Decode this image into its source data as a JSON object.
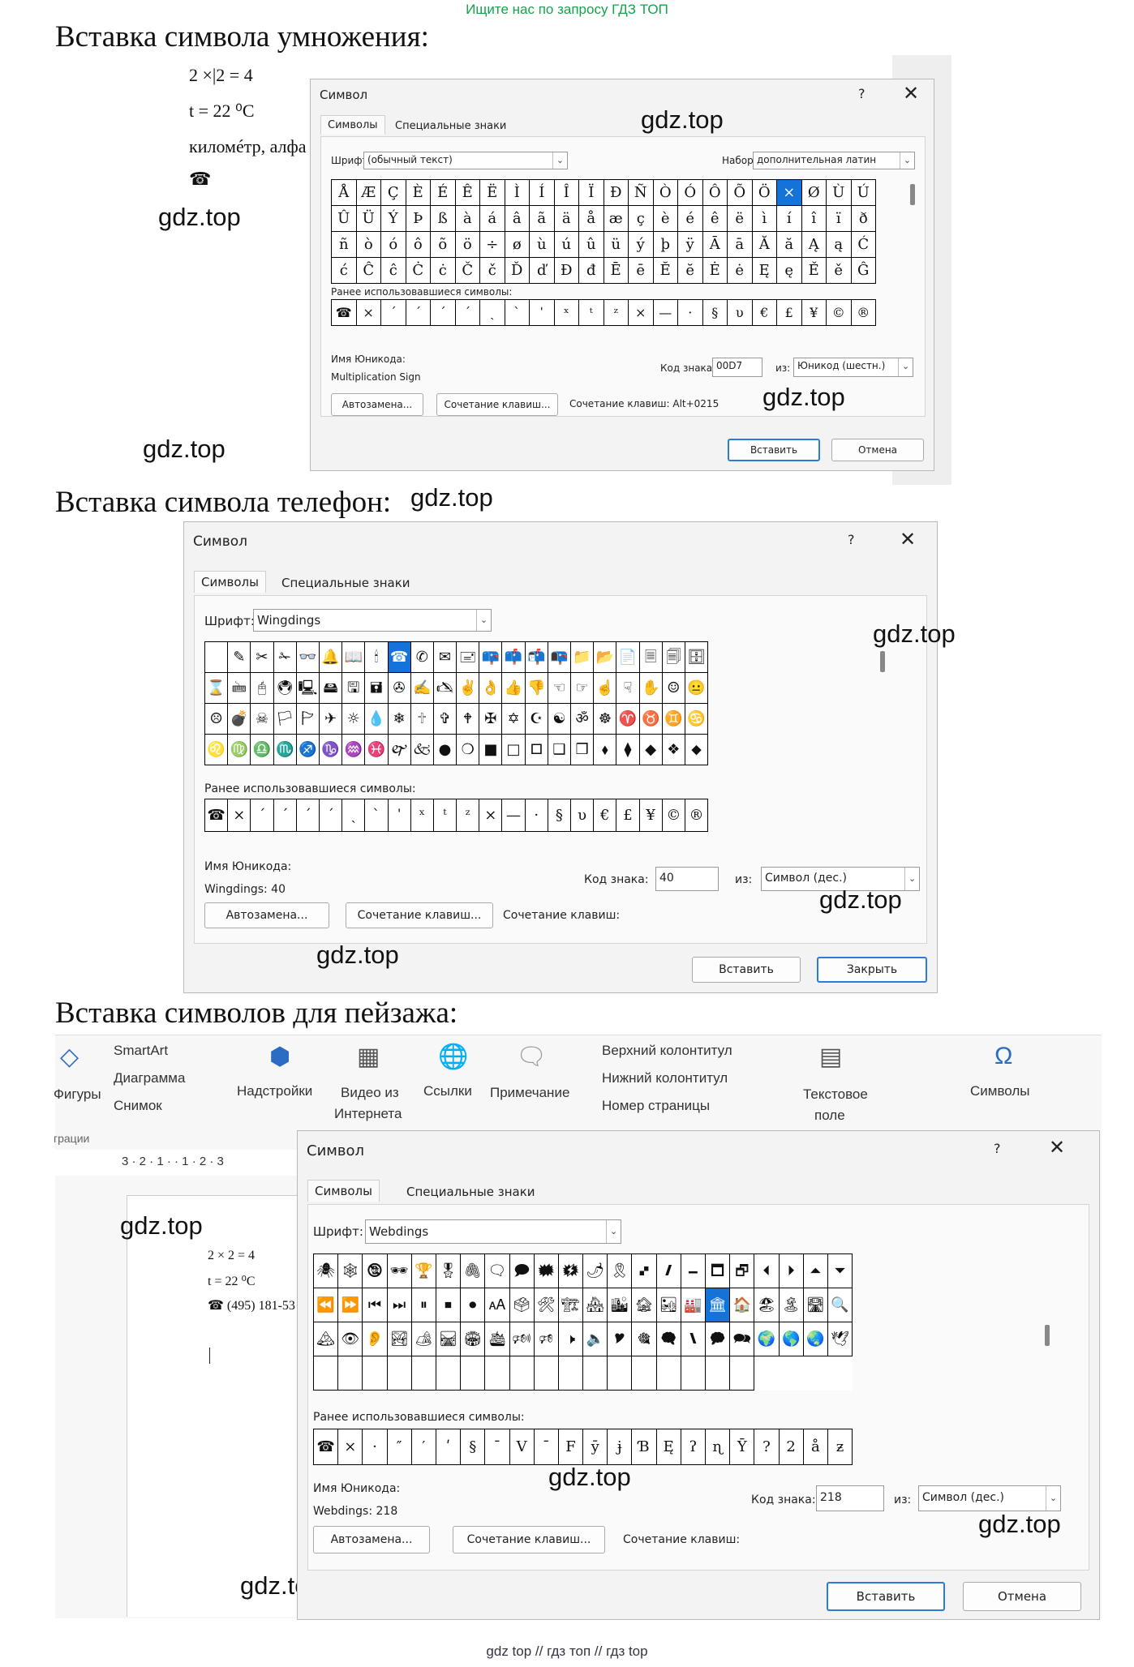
{
  "banner": "Ищите нас по запросу ГДЗ ТОП",
  "footer": "gdz top  //  гдз топ  //  гдз top",
  "watermark": "gdz.top",
  "sections": {
    "mult": "Вставка символа умножения:",
    "phone": "Вставка символа телефон:",
    "landscape": "Вставка символов для пейзажа:"
  },
  "doc1": {
    "line1": "2 ×|2 = 4",
    "line2": "t = 22 ⁰C",
    "line3": "киломéтр, алфа",
    "line4": "☎"
  },
  "dialog1": {
    "title": "Символ",
    "help": "?",
    "close": "✕",
    "tab_symbols": "Символы",
    "tab_special": "Специальные знаки",
    "font_label": "Шрифт:",
    "font_value": "(обычный текст)",
    "set_label": "Набор:",
    "set_value": "дополнительная латин",
    "cells": [
      "Å",
      "Æ",
      "Ç",
      "È",
      "É",
      "Ê",
      "Ë",
      "Ì",
      "Í",
      "Î",
      "Ï",
      "Ð",
      "Ñ",
      "Ò",
      "Ó",
      "Ô",
      "Õ",
      "Ö",
      "×",
      "Ø",
      "Ù",
      "Ú",
      "Û",
      "Ü",
      "Ý",
      "Þ",
      "ß",
      "à",
      "á",
      "â",
      "ã",
      "ä",
      "å",
      "æ",
      "ç",
      "è",
      "é",
      "ê",
      "ë",
      "ì",
      "í",
      "î",
      "ï",
      "ð",
      "ñ",
      "ò",
      "ó",
      "ô",
      "õ",
      "ö",
      "÷",
      "ø",
      "ù",
      "ú",
      "û",
      "ü",
      "ý",
      "þ",
      "ÿ",
      "Ā",
      "ā",
      "Ă",
      "ă",
      "Ą",
      "ą",
      "Ć",
      "ć",
      "Ĉ",
      "ĉ",
      "Ċ",
      "ċ",
      "Č",
      "č",
      "Ď",
      "ď",
      "Đ",
      "đ",
      "Ē",
      "ē",
      "Ĕ",
      "ĕ",
      "Ė",
      "ė",
      "Ę",
      "ę",
      "Ě",
      "ě",
      "Ĝ"
    ],
    "recent_label": "Ранее использовавшиеся символы:",
    "recent": [
      "☎",
      "×",
      "ˊ",
      "ˊ",
      "ˊ",
      "ˊ",
      "ˏ",
      "ˋ",
      "ˈ",
      "ˣ",
      "ᵗ",
      "ᶻ",
      "×",
      "—",
      "·",
      "§",
      "υ",
      "€",
      "£",
      "¥",
      "©",
      "®"
    ],
    "unicode_label": "Имя Юникода:",
    "unicode_name": "Multiplication Sign",
    "code_label": "Код знака:",
    "code_value": "00D7",
    "from_label": "из:",
    "from_value": "Юникод (шестн.)",
    "autocorrect": "Автозамена...",
    "shortcut_btn": "Сочетание клавиш...",
    "shortcut_text": "Сочетание клавиш: Alt+0215",
    "insert": "Вставить",
    "cancel": "Отмена"
  },
  "dialog2": {
    "title": "Символ",
    "help": "?",
    "close": "✕",
    "tab_symbols": "Символы",
    "tab_special": "Специальные знаки",
    "font_label": "Шрифт:",
    "font_value": "Wingdings",
    "cells": [
      " ",
      "✎",
      "✂",
      "✁",
      "👓",
      "🔔",
      "📖",
      "🕯",
      "☎",
      "✆",
      "✉",
      "🖃",
      "📪",
      "📫",
      "📬",
      "📭",
      "📁",
      "📂",
      "📄",
      "🗏",
      "🗐",
      "🗄",
      "⌛",
      "🖮",
      "🖰",
      "🖲",
      "🖳",
      "🖴",
      "🖫",
      "🖬",
      "✇",
      "✍",
      "🖎",
      "✌",
      "👌",
      "👍",
      "👎",
      "☜",
      "☞",
      "☝",
      "☟",
      "✋",
      "☺",
      "😐",
      "☹",
      "💣",
      "☠",
      "🏳",
      "🏱",
      "✈",
      "☼",
      "💧",
      "❄",
      "🕆",
      "✞",
      "🕈",
      "✠",
      "✡",
      "☪",
      "☯",
      "ॐ",
      "☸",
      "♈",
      "♉",
      "♊",
      "♋",
      "♌",
      "♍",
      "♎",
      "♏",
      "♐",
      "♑",
      "♒",
      "♓",
      "🙰",
      "🙵",
      "●",
      "❍",
      "■",
      "□",
      "🞐",
      "❑",
      "❒",
      "⬧",
      "⧫",
      "◆",
      "❖",
      "⬥"
    ],
    "recent_label": "Ранее использовавшиеся символы:",
    "recent": [
      "☎",
      "×",
      "ˊ",
      "ˊ",
      "ˊ",
      "ˊ",
      "ˏ",
      "ˋ",
      "ˈ",
      "ˣ",
      "ᵗ",
      "ᶻ",
      "×",
      "—",
      "·",
      "§",
      "υ",
      "€",
      "£",
      "¥",
      "©",
      "®"
    ],
    "unicode_label": "Имя Юникода:",
    "unicode_name": "Wingdings: 40",
    "code_label": "Код знака:",
    "code_value": "40",
    "from_label": "из:",
    "from_value": "Символ (дес.)",
    "autocorrect": "Автозамена...",
    "shortcut_btn": "Сочетание клавиш...",
    "shortcut_text": "Сочетание клавиш:",
    "insert": "Вставить",
    "cancel": "Закрыть"
  },
  "ribbon": {
    "shapes": "Фигуры",
    "smartart": "SmartArt",
    "chart": "Диаграмма",
    "screenshot": "Снимок",
    "addins": "Надстройки",
    "video": "Видео из",
    "video2": "Интернета",
    "links": "Ссылки",
    "comment": "Примечание",
    "header": "Верхний колонтитул",
    "footer": "Нижний колонтитул",
    "pagenum": "Номер страницы",
    "textbox": "Текстовое",
    "textbox2": "поле",
    "symbols": "Символы",
    "illustrations": "грации",
    "ruler": "3 · 2 · 1 ·   · 1 · 2 · 3"
  },
  "doc3": {
    "line1": "2 × 2 = 4",
    "line2": "t = 22 ⁰C",
    "line3": "☎ (495) 181-53"
  },
  "dialog3": {
    "title": "Символ",
    "help": "?",
    "close": "✕",
    "tab_symbols": "Символы",
    "tab_special": "Специальные знаки",
    "font_label": "Шрифт:",
    "font_value": "Webdings",
    "cells": [
      "🕷",
      "🕸",
      "🕲",
      "🕶",
      "🏆",
      "🎖",
      "🖇",
      "🗨",
      "🗩",
      "🗰",
      "🗱",
      "🌶",
      "🎗",
      "🙾",
      "🙼",
      "🗕",
      "🗖",
      "🗗",
      "⏴",
      "⏵",
      "⏶",
      "⏷",
      "⏪",
      "⏩",
      "⏮",
      "⏭",
      "⏸",
      "⏹",
      "⏺",
      "🗚",
      "🗳",
      "🛠",
      "🏗",
      "🏘",
      "🏙",
      "🏚",
      "🏜",
      "🏭",
      "🏛",
      "🏠",
      "🏖",
      "🏝",
      "🛣",
      "🔍",
      "🏔",
      "👁",
      "👂",
      "🏞",
      "🏕",
      "🛤",
      "🏟",
      "🛳",
      "🕬",
      "🕫",
      "🕨",
      "🔈",
      "🎔",
      "🎕",
      "🗬",
      "🙽",
      "🗭",
      "🗪",
      "🌍",
      "🌎",
      "🌏",
      "🕊",
      "",
      "",
      "",
      "",
      "",
      "",
      "",
      "",
      "",
      "",
      "",
      "",
      "",
      "",
      "",
      "",
      "",
      ""
    ],
    "recent_label": "Ранее использовавшиеся символы:",
    "recent": [
      "☎",
      "×",
      "·",
      "″",
      "′",
      "ʹ",
      "§",
      "¯",
      "Ⅴ",
      "ˉ",
      "F",
      "ȳ",
      "ɉ",
      "Ɓ",
      "Ę",
      "ʔ",
      "ɳ",
      "Ȳ",
      "?",
      "2",
      "å",
      "ƶ"
    ],
    "unicode_label": "Имя Юникода:",
    "unicode_name": "Webdings: 218",
    "code_label": "Код знака:",
    "code_value": "218",
    "from_label": "из:",
    "from_value": "Символ (дес.)",
    "autocorrect": "Автозамена...",
    "shortcut_btn": "Сочетание клавиш...",
    "shortcut_text": "Сочетание клавиш:",
    "insert": "Вставить",
    "cancel": "Отмена"
  }
}
